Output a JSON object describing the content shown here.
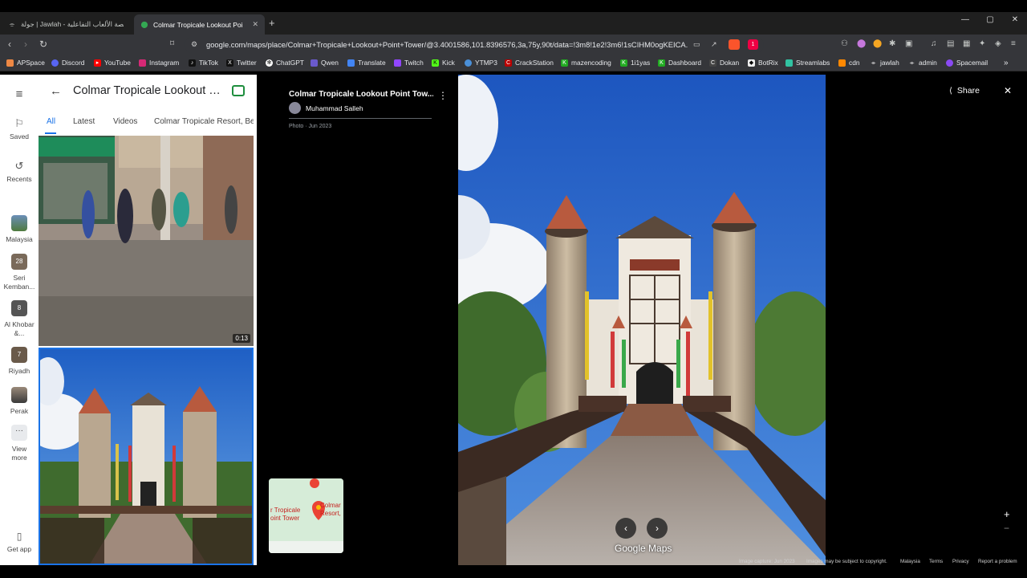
{
  "browser": {
    "tabs": [
      {
        "label": "جولة | Jawlah - منصة الألعاب التفاعلية",
        "active": false
      },
      {
        "label": "Colmar Tropicale Lookout Point",
        "active": true
      }
    ],
    "url": "google.com/maps/place/Colmar+Tropicale+Lookout+Point+Tower/@3.4001586,101.8396576,3a,75y,90t/data=!3m8!1e2!3m6!1sCIHM0ogKEICA...",
    "extension_badge": "1",
    "bookmarks": [
      "APSpace",
      "Discord",
      "YouTube",
      "Instagram",
      "TikTok",
      "Twitter",
      "ChatGPT",
      "Qwen",
      "Translate",
      "Twitch",
      "Kick",
      "YTMP3",
      "CrackStation",
      "mazencoding",
      "1i1yas",
      "Dashboard",
      "Dokan",
      "BotRix",
      "Streamlabs",
      "cdn",
      "jawlah",
      "admin",
      "Spacemail"
    ]
  },
  "rail": {
    "saved": "Saved",
    "recents": "Recents",
    "places": [
      {
        "label": "Malaysia"
      },
      {
        "label": "Seri Kemban...",
        "badge": "28"
      },
      {
        "label": "Al Khobar &...",
        "badge": "8"
      },
      {
        "label": "Riyadh",
        "badge": "7"
      },
      {
        "label": "Perak"
      }
    ],
    "view_more": "View more",
    "get_app": "Get app"
  },
  "panel": {
    "title": "Colmar Tropicale Lookout Poi...",
    "tabs": [
      "All",
      "Latest",
      "Videos",
      "Colmar Tropicale Resort, Be"
    ],
    "video_duration": "0:13"
  },
  "photo_info": {
    "title": "Colmar Tropicale Lookout Point Tow...",
    "author": "Muhammad Salleh",
    "meta": "Photo · Jun 2023"
  },
  "minimap": {
    "label_left": "r Tropicale\noint Tower",
    "label_right": "Colmar\nResort,"
  },
  "viewer": {
    "share": "Share",
    "watermark": "Google Maps",
    "image_capture": "Image capture: Jun 2023",
    "copyright": "Images may be subject to copyright.",
    "links": [
      "Malaysia",
      "Terms",
      "Privacy",
      "Report a problem"
    ]
  },
  "colors": {
    "accent": "#1a73e8",
    "sky": "#2f78d6"
  }
}
